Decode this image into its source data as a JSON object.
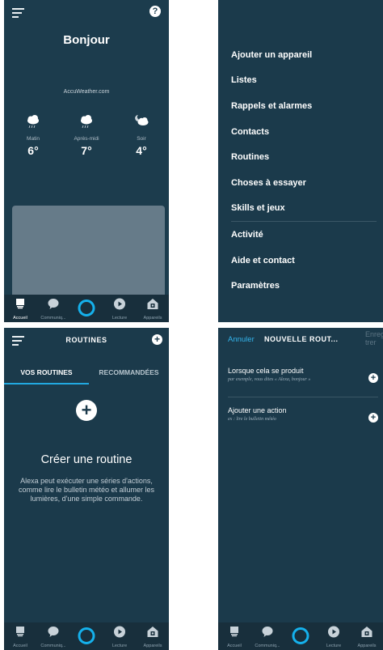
{
  "home": {
    "title": "Bonjour",
    "weather_source": "AccuWeather.com",
    "forecast": [
      {
        "label": "Matin",
        "temp": "6°",
        "icon": "rain-cloud-icon"
      },
      {
        "label": "Après-midi",
        "temp": "7°",
        "icon": "rain-cloud-icon"
      },
      {
        "label": "Soir",
        "temp": "4°",
        "icon": "partly-cloudy-night-icon"
      }
    ]
  },
  "menu": {
    "items": [
      "Ajouter un appareil",
      "Listes",
      "Rappels et alarmes",
      "Contacts",
      "Routines",
      "Choses à essayer",
      "Skills et jeux",
      "Activité",
      "Aide et contact",
      "Paramètres"
    ]
  },
  "routines": {
    "title": "ROUTINES",
    "tabs": [
      "VOS ROUTINES",
      "RECOMMANDÉES"
    ],
    "create_title": "Créer une routine",
    "create_desc": "Alexa peut exécuter une séries d'actions, comme lire le bulletin météo et allumer les lumières, d'une simple commande."
  },
  "new_routine": {
    "cancel": "Annuler",
    "title": "NOUVELLE ROUT...",
    "save": "Enregis-trer",
    "rows": [
      {
        "title": "Lorsque cela se produit",
        "subtitle": "par exemple, vous dites « Alexa, bonjour »"
      },
      {
        "title": "Ajouter une action",
        "subtitle": "ex : lire le bulletin météo"
      }
    ]
  },
  "nav": {
    "items": [
      "Accueil",
      "Communiq...",
      "",
      "Lecture",
      "Appareils"
    ]
  },
  "colors": {
    "panel_bg": "#1b3a4b",
    "accent": "#15b1ec",
    "card": "#667b89"
  }
}
